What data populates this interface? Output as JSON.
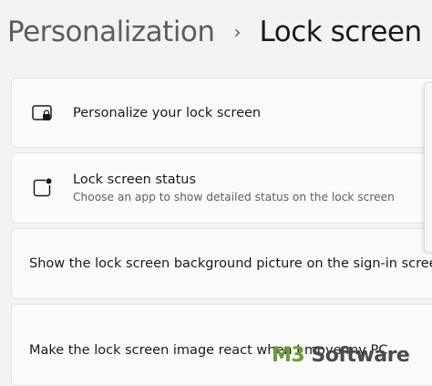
{
  "breadcrumb": {
    "parent": "Personalization",
    "separator": "›",
    "current": "Lock screen"
  },
  "settings": [
    {
      "icon": "lock-screen-picture-icon",
      "title": "Personalize your lock screen"
    },
    {
      "icon": "lock-screen-status-icon",
      "title": "Lock screen status",
      "description": "Choose an app to show detailed status on the lock screen"
    },
    {
      "title": "Show the lock screen background picture on the sign-in screen"
    },
    {
      "title": "Make the lock screen image react when I move my PC"
    }
  ],
  "watermark": {
    "brand": "M3",
    "name": " Software"
  }
}
